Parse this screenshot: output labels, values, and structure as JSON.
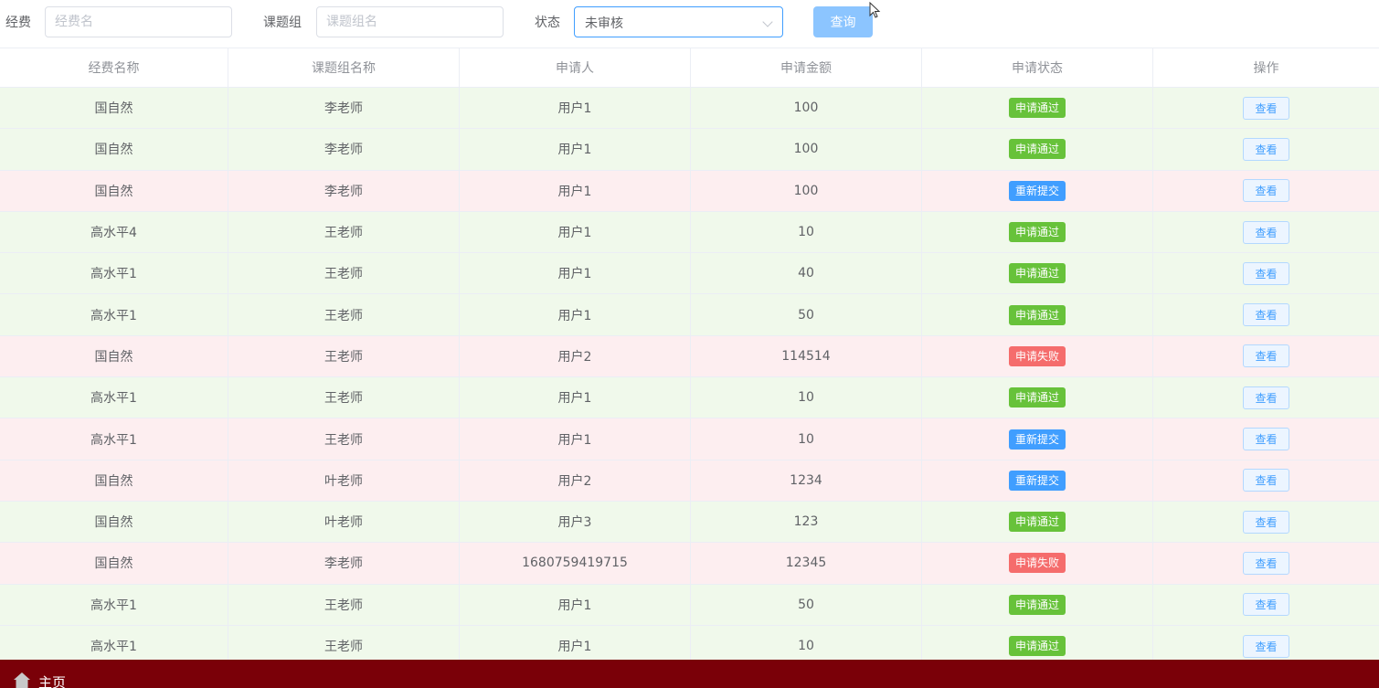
{
  "filters": {
    "fund_label": "经费",
    "fund_placeholder": "经费名",
    "group_label": "课题组",
    "group_placeholder": "课题组名",
    "status_label": "状态",
    "status_value": "未审核",
    "query_label": "查询"
  },
  "table": {
    "headers": [
      "经费名称",
      "课题组名称",
      "申请人",
      "申请金额",
      "申请状态",
      "操作"
    ],
    "rows": [
      {
        "fund": "国自然",
        "group": "李老师",
        "applicant": "用户1",
        "amount": "100",
        "status": "申请通过",
        "action": "查看"
      },
      {
        "fund": "国自然",
        "group": "李老师",
        "applicant": "用户1",
        "amount": "100",
        "status": "申请通过",
        "action": "查看"
      },
      {
        "fund": "国自然",
        "group": "李老师",
        "applicant": "用户1",
        "amount": "100",
        "status": "重新提交",
        "action": "查看"
      },
      {
        "fund": "高水平4",
        "group": "王老师",
        "applicant": "用户1",
        "amount": "10",
        "status": "申请通过",
        "action": "查看"
      },
      {
        "fund": "高水平1",
        "group": "王老师",
        "applicant": "用户1",
        "amount": "40",
        "status": "申请通过",
        "action": "查看"
      },
      {
        "fund": "高水平1",
        "group": "王老师",
        "applicant": "用户1",
        "amount": "50",
        "status": "申请通过",
        "action": "查看"
      },
      {
        "fund": "国自然",
        "group": "王老师",
        "applicant": "用户2",
        "amount": "114514",
        "status": "申请失败",
        "action": "查看"
      },
      {
        "fund": "高水平1",
        "group": "王老师",
        "applicant": "用户1",
        "amount": "10",
        "status": "申请通过",
        "action": "查看"
      },
      {
        "fund": "高水平1",
        "group": "王老师",
        "applicant": "用户1",
        "amount": "10",
        "status": "重新提交",
        "action": "查看"
      },
      {
        "fund": "国自然",
        "group": "叶老师",
        "applicant": "用户2",
        "amount": "1234",
        "status": "重新提交",
        "action": "查看"
      },
      {
        "fund": "国自然",
        "group": "叶老师",
        "applicant": "用户3",
        "amount": "123",
        "status": "申请通过",
        "action": "查看"
      },
      {
        "fund": "国自然",
        "group": "李老师",
        "applicant": "1680759419715",
        "amount": "12345",
        "status": "申请失败",
        "action": "查看"
      },
      {
        "fund": "高水平1",
        "group": "王老师",
        "applicant": "用户1",
        "amount": "50",
        "status": "申请通过",
        "action": "查看"
      },
      {
        "fund": "高水平1",
        "group": "王老师",
        "applicant": "用户1",
        "amount": "10",
        "status": "申请通过",
        "action": "查看"
      }
    ]
  },
  "colors": {
    "pass": "#67c23a",
    "resubmit": "#409eff",
    "fail": "#f56c6c",
    "row_success": "#f0f9eb",
    "row_danger": "#fdeef0",
    "footer": "#7a0008"
  },
  "footer": {
    "home_label": "主页",
    "home_icon": "home-icon"
  }
}
